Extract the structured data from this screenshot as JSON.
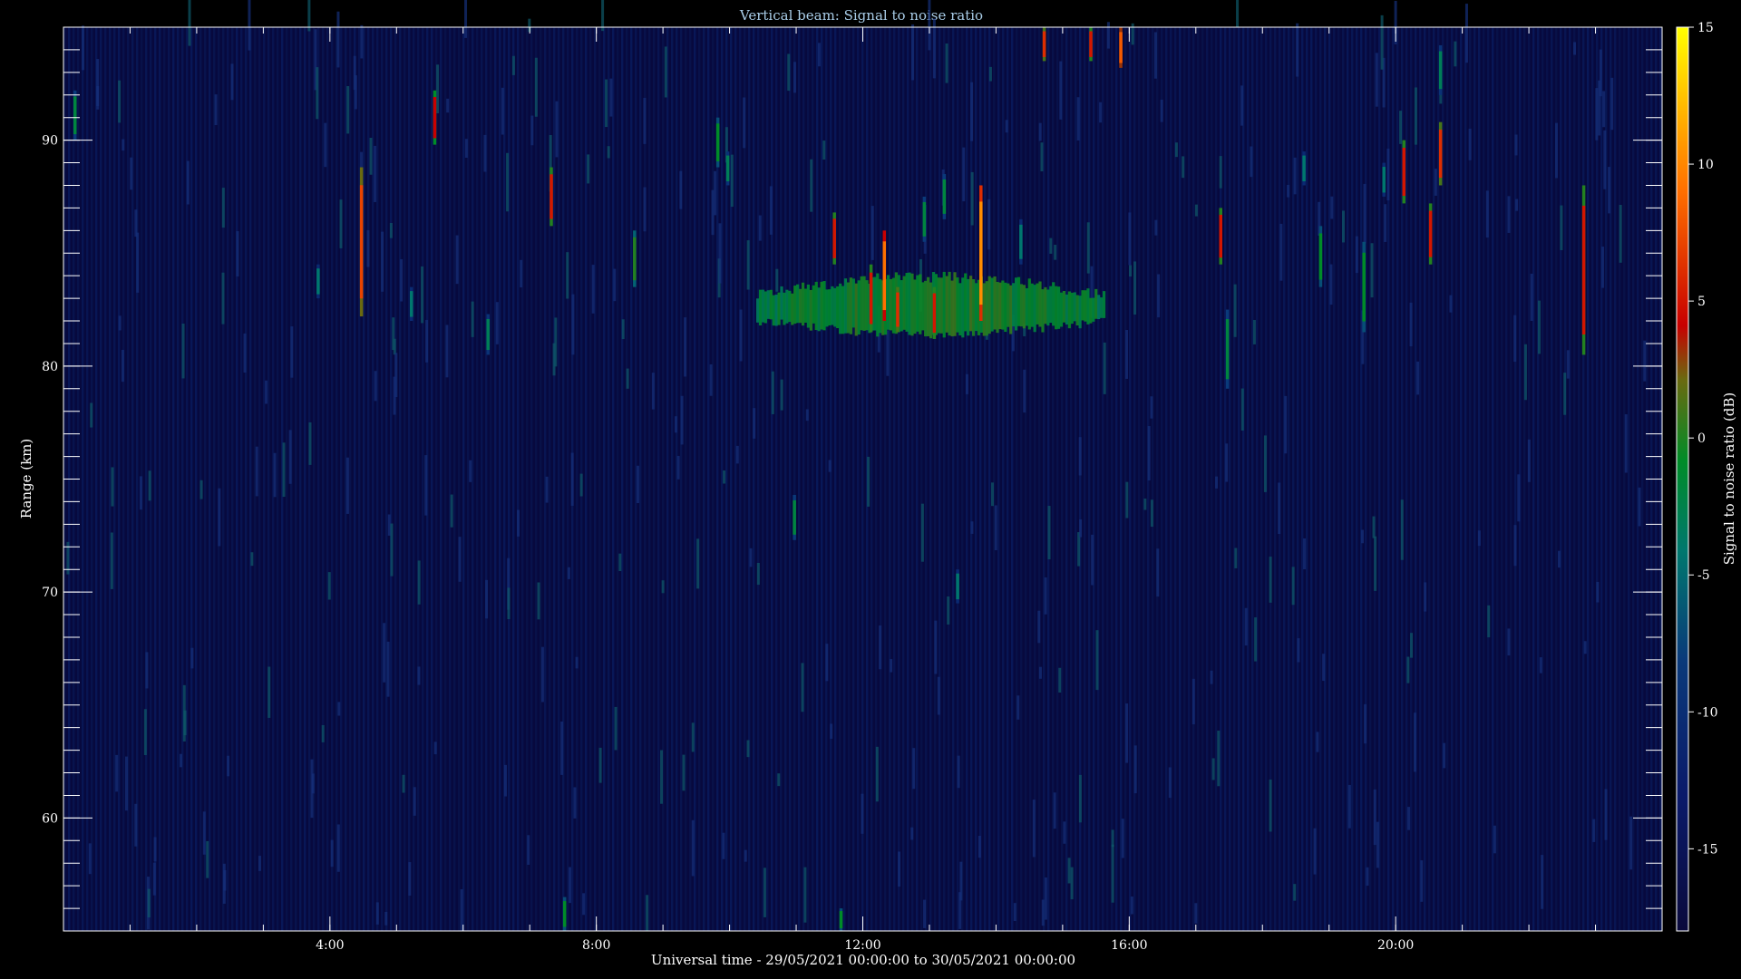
{
  "chart_data": {
    "type": "heatmap",
    "title": "Vertical beam: Signal to noise ratio",
    "xlabel": "Universal time - 29/05/2021 00:00:00 to 30/05/2021 00:00:00",
    "ylabel": "Range (km)",
    "colorbar_label": "Signal to noise ratio (dB)",
    "x_unit": "hours UT",
    "xlim": [
      0,
      24
    ],
    "ylim": [
      55,
      95
    ],
    "clim": [
      -18,
      15
    ],
    "x_ticks": [
      {
        "value": 4,
        "label": "4:00"
      },
      {
        "value": 8,
        "label": "8:00"
      },
      {
        "value": 12,
        "label": "12:00"
      },
      {
        "value": 16,
        "label": "16:00"
      },
      {
        "value": 20,
        "label": "20:00"
      }
    ],
    "y_ticks": [
      {
        "value": 60,
        "label": "60"
      },
      {
        "value": 70,
        "label": "70"
      },
      {
        "value": 80,
        "label": "80"
      },
      {
        "value": 90,
        "label": "90"
      }
    ],
    "c_ticks": [
      {
        "value": 15,
        "label": "15"
      },
      {
        "value": 10,
        "label": "10"
      },
      {
        "value": 5,
        "label": "5"
      },
      {
        "value": 0,
        "label": "0"
      },
      {
        "value": -5,
        "label": "-5"
      },
      {
        "value": -10,
        "label": "-10"
      },
      {
        "value": -15,
        "label": "-15"
      }
    ],
    "background_snr": -16,
    "echo_layer": {
      "t_start": 10.4,
      "t_end": 15.6,
      "range_low": 81.2,
      "range_high": 84.2,
      "snr_typical": -6
    },
    "echoes": [
      {
        "t": 0.15,
        "r0": 90.0,
        "r1": 92.2,
        "snr": -6
      },
      {
        "t": 4.45,
        "r0": 82.2,
        "r1": 88.8,
        "snr": 3
      },
      {
        "t": 5.55,
        "r0": 89.8,
        "r1": 92.2,
        "snr": 0
      },
      {
        "t": 7.3,
        "r0": 86.2,
        "r1": 88.8,
        "snr": 1
      },
      {
        "t": 8.55,
        "r0": 83.5,
        "r1": 86.0,
        "snr": -4
      },
      {
        "t": 9.8,
        "r0": 88.8,
        "r1": 91.0,
        "snr": -5
      },
      {
        "t": 11.55,
        "r0": 84.5,
        "r1": 86.8,
        "snr": 1
      },
      {
        "t": 12.1,
        "r0": 81.5,
        "r1": 84.5,
        "snr": 1
      },
      {
        "t": 12.3,
        "r0": 82.0,
        "r1": 86.0,
        "snr": 5
      },
      {
        "t": 12.5,
        "r0": 81.5,
        "r1": 83.5,
        "snr": 2
      },
      {
        "t": 13.05,
        "r0": 81.2,
        "r1": 83.5,
        "snr": 1
      },
      {
        "t": 13.75,
        "r0": 82.0,
        "r1": 88.0,
        "snr": 7
      },
      {
        "t": 14.7,
        "r0": 93.5,
        "r1": 95.0,
        "snr": 2
      },
      {
        "t": 15.4,
        "r0": 93.5,
        "r1": 95.0,
        "snr": 1
      },
      {
        "t": 15.85,
        "r0": 93.2,
        "r1": 95.0,
        "snr": 4
      },
      {
        "t": 17.35,
        "r0": 84.5,
        "r1": 87.0,
        "snr": 1
      },
      {
        "t": 17.45,
        "r0": 79.0,
        "r1": 82.5,
        "snr": -6
      },
      {
        "t": 18.85,
        "r0": 83.5,
        "r1": 86.2,
        "snr": -5
      },
      {
        "t": 19.5,
        "r0": 81.5,
        "r1": 85.5,
        "snr": -5
      },
      {
        "t": 20.1,
        "r0": 87.2,
        "r1": 90.0,
        "snr": 1
      },
      {
        "t": 20.5,
        "r0": 84.5,
        "r1": 87.2,
        "snr": 1
      },
      {
        "t": 20.65,
        "r0": 88.0,
        "r1": 90.8,
        "snr": 2
      },
      {
        "t": 20.65,
        "r0": 92.0,
        "r1": 94.2,
        "snr": -7
      },
      {
        "t": 22.8,
        "r0": 80.5,
        "r1": 88.0,
        "snr": 1
      },
      {
        "t": 7.5,
        "r0": 55.0,
        "r1": 56.5,
        "snr": -5
      },
      {
        "t": 11.65,
        "r0": 55.0,
        "r1": 56.0,
        "snr": -5
      },
      {
        "t": 10.95,
        "r0": 72.3,
        "r1": 74.3,
        "snr": -6
      },
      {
        "t": 13.4,
        "r0": 69.5,
        "r1": 71.0,
        "snr": -8
      },
      {
        "t": 6.35,
        "r0": 80.5,
        "r1": 82.3,
        "snr": -7
      },
      {
        "t": 3.8,
        "r0": 83.0,
        "r1": 84.5,
        "snr": -8
      },
      {
        "t": 5.2,
        "r0": 82.0,
        "r1": 83.5,
        "snr": -8
      },
      {
        "t": 9.95,
        "r0": 88.0,
        "r1": 89.5,
        "snr": -7
      },
      {
        "t": 13.2,
        "r0": 86.5,
        "r1": 88.5,
        "snr": -6
      },
      {
        "t": 12.9,
        "r0": 85.5,
        "r1": 87.5,
        "snr": -6
      },
      {
        "t": 14.35,
        "r0": 84.5,
        "r1": 86.5,
        "snr": -8
      },
      {
        "t": 18.6,
        "r0": 88.0,
        "r1": 89.5,
        "snr": -8
      },
      {
        "t": 19.8,
        "r0": 87.5,
        "r1": 89.0,
        "snr": -8
      }
    ]
  }
}
